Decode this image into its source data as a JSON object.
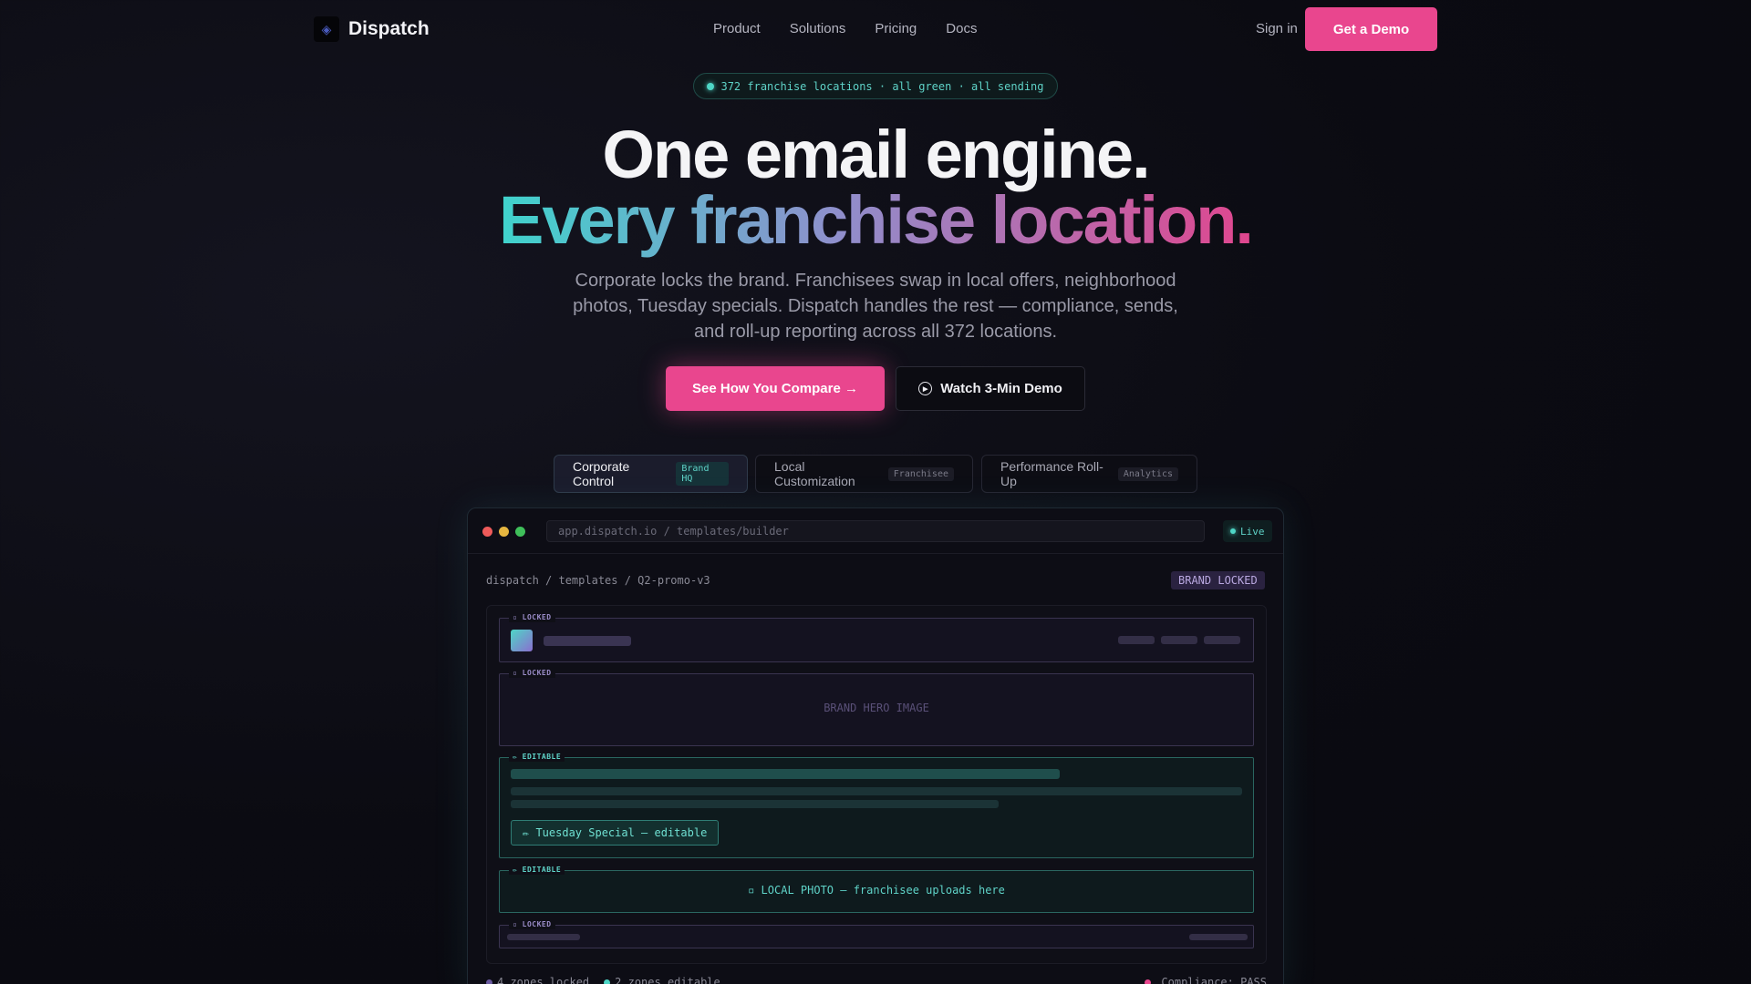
{
  "nav": {
    "brand": "Dispatch",
    "logo_icon": "◈",
    "links": [
      "Product",
      "Solutions",
      "Pricing",
      "Docs"
    ],
    "signin": "Sign in",
    "demo": "Get a Demo"
  },
  "status": {
    "text": "372 franchise locations · all green · all sending"
  },
  "hero": {
    "line1": "One email engine.",
    "line2": "Every franchise location.",
    "subtitle": "Corporate locks the brand. Franchisees swap in local offers, neighborhood photos, Tuesday specials. Dispatch handles the rest — compliance, sends, and roll-up reporting across all 372 locations.",
    "cta_primary": "See How You Compare →",
    "cta_secondary": "Watch 3-Min Demo"
  },
  "tabs": [
    {
      "label": "Corporate Control",
      "tag": "Brand HQ",
      "active": true
    },
    {
      "label": "Local Customization",
      "tag": "Franchisee",
      "active": false
    },
    {
      "label": "Performance Roll-Up",
      "tag": "Analytics",
      "active": false
    }
  ],
  "window": {
    "url": "app.dispatch.io / templates/builder",
    "live": "Live",
    "breadcrumb": "dispatch / templates / Q2-promo-v3",
    "badge": "BRAND LOCKED",
    "zones": {
      "locked_label": "▫ LOCKED",
      "editable_label": "✏ EDITABLE",
      "hero_text": "BRAND HERO IMAGE",
      "tuesday": "✏ Tuesday Special — editable",
      "photo": "▫ LOCAL PHOTO — franchisee uploads here"
    },
    "footer": {
      "locked": "4 zones locked",
      "editable": "2 zones editable",
      "compliance": "Compliance: PASS"
    }
  },
  "colors": {
    "accent_pink": "#e9468e",
    "accent_teal": "#4ed6c6",
    "locked_purple": "#9a8cc8"
  }
}
